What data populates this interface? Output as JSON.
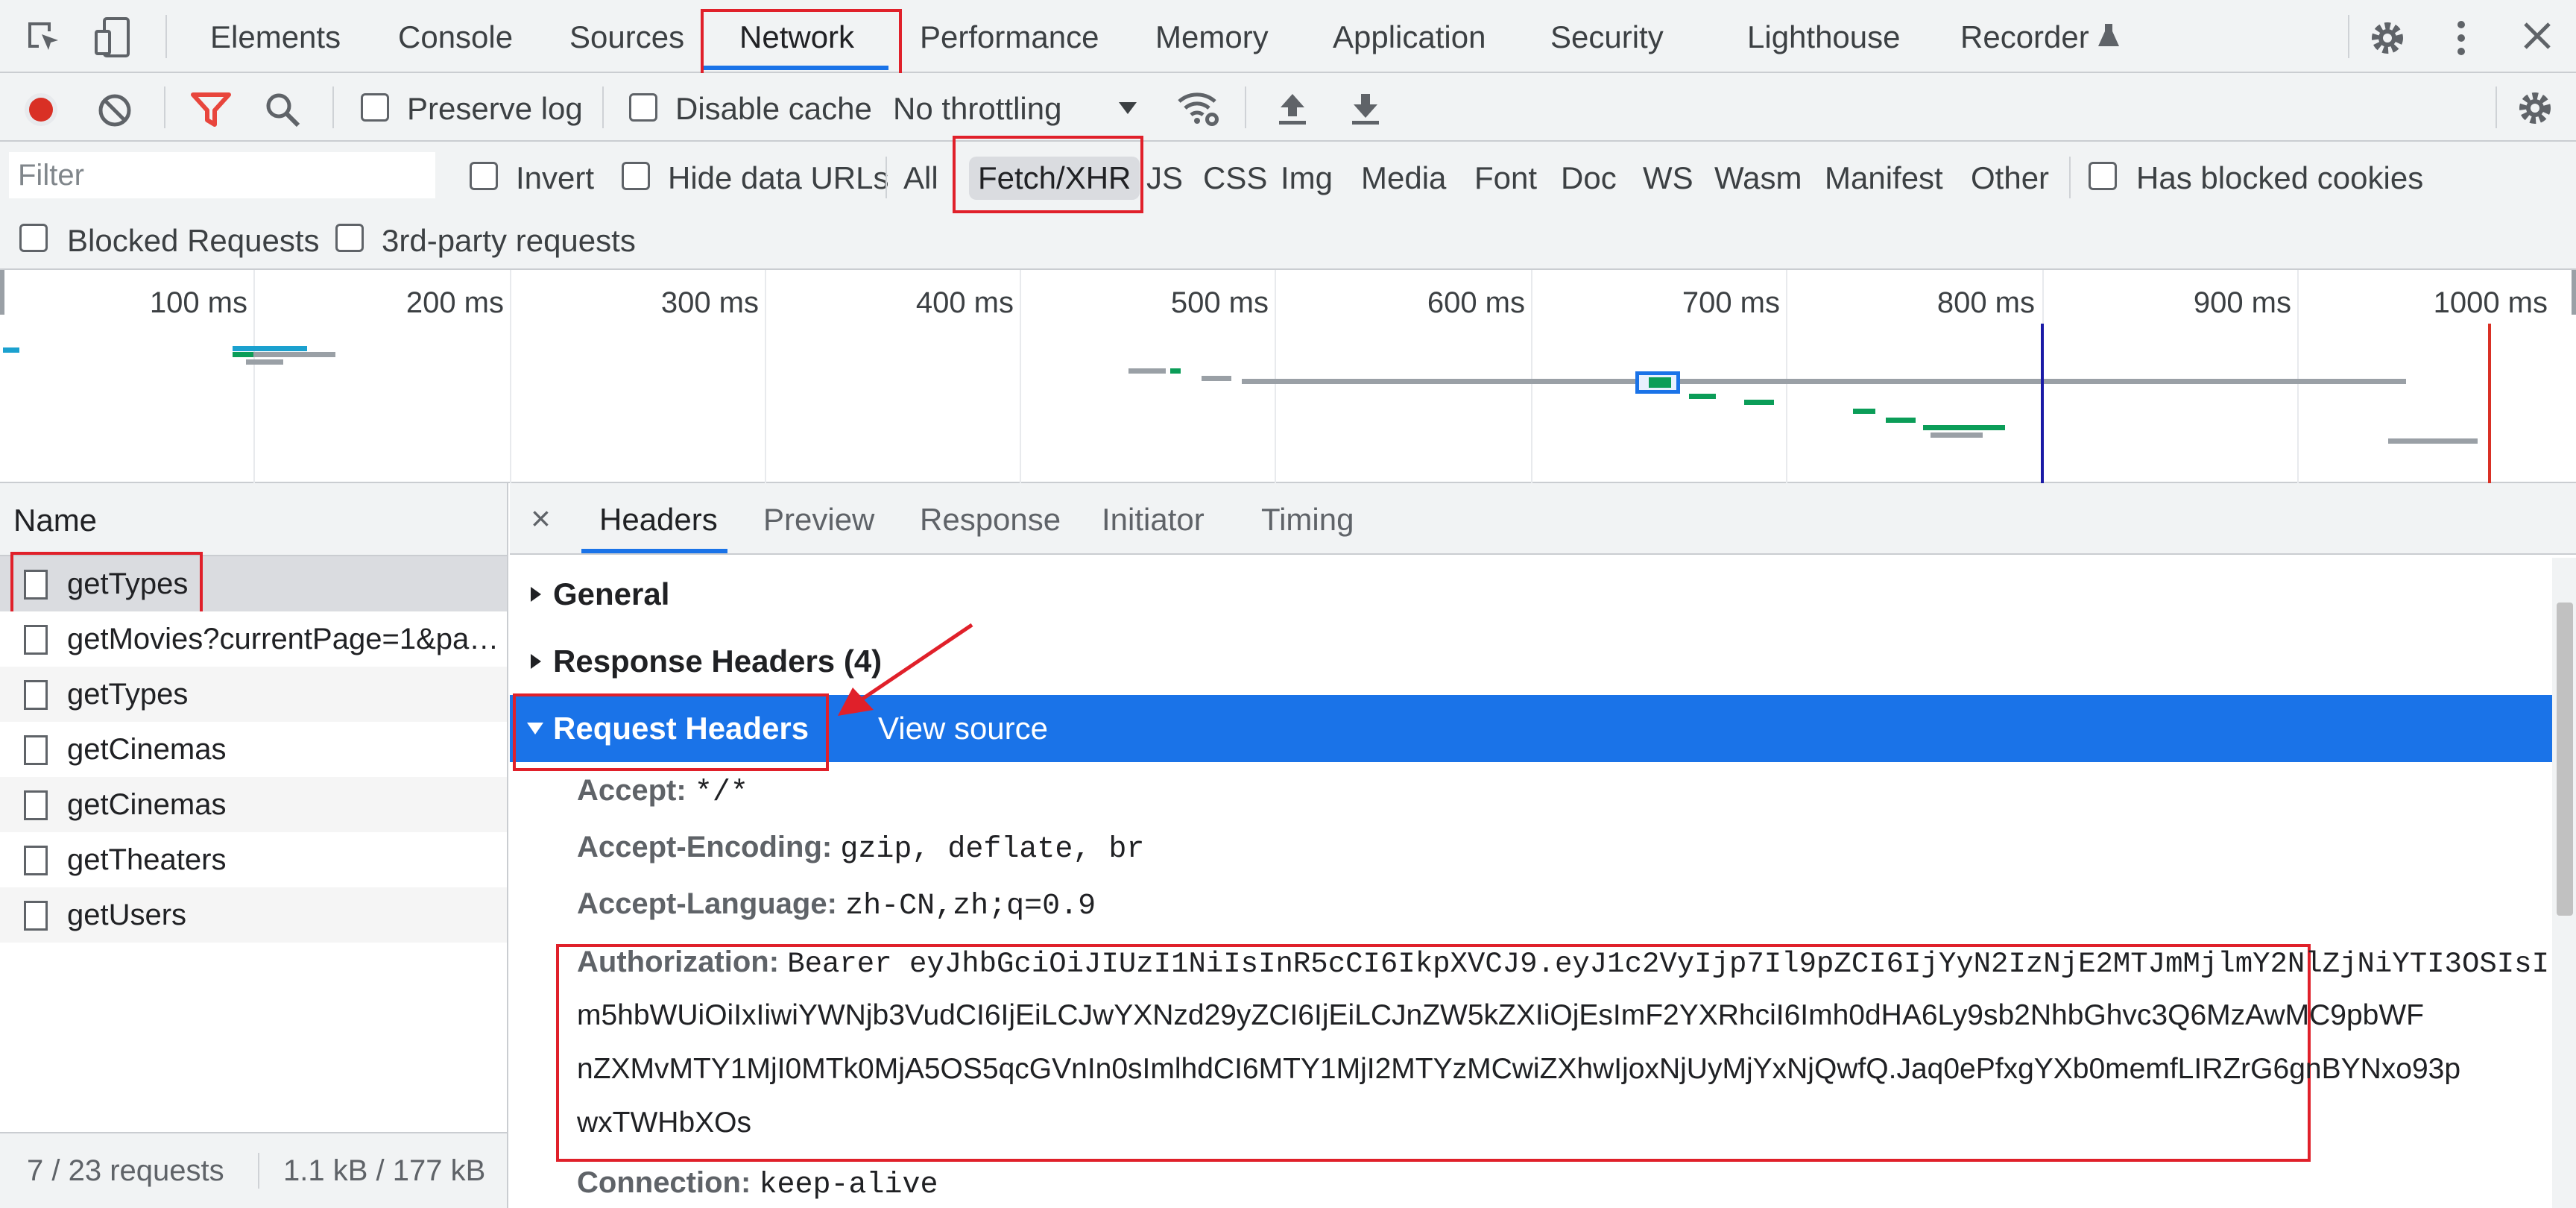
{
  "tabs": [
    "Elements",
    "Console",
    "Sources",
    "Network",
    "Performance",
    "Memory",
    "Application",
    "Security",
    "Lighthouse",
    "Recorder"
  ],
  "active_tab": "Network",
  "toolbar": {
    "preserve_log": "Preserve log",
    "disable_cache": "Disable cache",
    "throttling": "No throttling"
  },
  "filter": {
    "placeholder": "Filter",
    "invert": "Invert",
    "hide_data_urls": "Hide data URLs",
    "types": [
      "All",
      "Fetch/XHR",
      "JS",
      "CSS",
      "Img",
      "Media",
      "Font",
      "Doc",
      "WS",
      "Wasm",
      "Manifest",
      "Other"
    ],
    "active_type": "Fetch/XHR",
    "has_blocked_cookies": "Has blocked cookies",
    "blocked_requests": "Blocked Requests",
    "third_party": "3rd-party requests"
  },
  "overview": {
    "ticks": [
      "100 ms",
      "200 ms",
      "300 ms",
      "400 ms",
      "500 ms",
      "600 ms",
      "700 ms",
      "800 ms",
      "900 ms",
      "1000 ms"
    ]
  },
  "requests": {
    "header": "Name",
    "items": [
      "getTypes",
      "getMovies?currentPage=1&pageSize=10",
      "getTypes",
      "getCinemas",
      "getCinemas",
      "getTheaters",
      "getUsers"
    ],
    "status_count": "7 / 23 requests",
    "status_size": "1.1 kB / 177 kB"
  },
  "details": {
    "close": "×",
    "tabs": [
      "Headers",
      "Preview",
      "Response",
      "Initiator",
      "Timing"
    ],
    "active_tab": "Headers",
    "general": "General",
    "response_headers": "Response Headers (4)",
    "request_headers": "Request Headers",
    "view_source": "View source",
    "headers": [
      {
        "name": "Accept:",
        "value": "*/*"
      },
      {
        "name": "Accept-Encoding:",
        "value": "gzip, deflate, br"
      },
      {
        "name": "Accept-Language:",
        "value": "zh-CN,zh;q=0.9"
      }
    ],
    "authorization": {
      "name": "Authorization:",
      "line1": "Bearer eyJhbGciOiJIUzI1NiIsInR5cCI6IkpXVCJ9.eyJ1c2VyIjp7Il9pZCI6IjYyN2IzNjE2MTJmMjlmY2NlZjNiYTI3OSIsI",
      "line2": "m5hbWUiOiIxIiwiYWNjb3VudCI6IjEiLCJwYXNzd29yZCI6IjEiLCJnZW5kZXIiOjEsImF2YXRhciI6Imh0dHA6Ly9sb2NhbGhvc3Q6MzAwMC9pbWF",
      "line3": "nZXMvMTY1MjI0MTk0MjA5OS5qcGVnIn0sImlhdCI6MTY1MjI2MTYzMCwiZXhwIjoxNjUyMjYxNjQwfQ.Jaq0ePfxgYXb0memfLIRZrG6gnBYNxo93p",
      "line4": "wxTWHbXOs"
    },
    "connection": {
      "name": "Connection:",
      "value": "keep-alive"
    }
  },
  "colors": {
    "accent": "#1a73e8",
    "record": "#d93025",
    "filter_active": "#e8453c",
    "annotation": "#e0202a",
    "bar_green": "#0b9d58",
    "bar_gray": "#9aa0a6",
    "bar_teal": "#1ba1cf",
    "dom_line": "#1a1aa6",
    "load_line": "#d93025"
  }
}
